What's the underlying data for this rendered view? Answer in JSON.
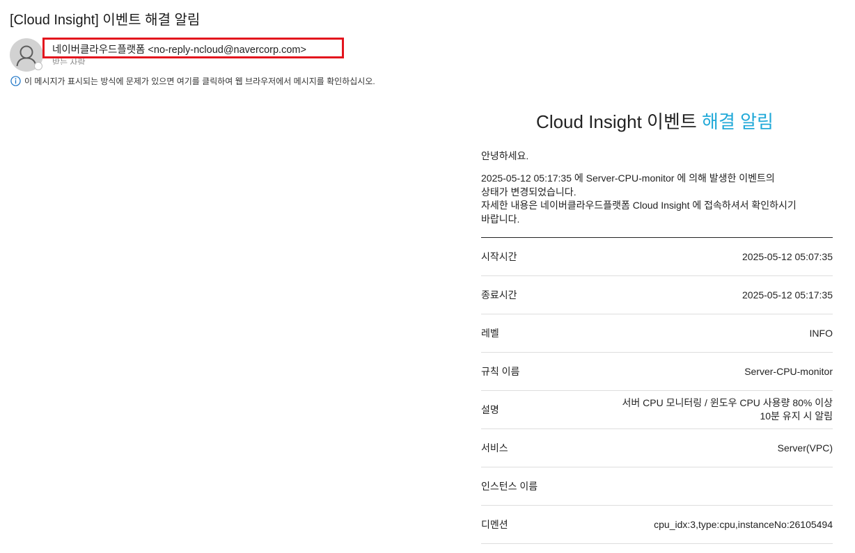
{
  "email": {
    "subject": "[Cloud Insight] 이벤트 해결 알림",
    "sender": "네이버클라우드플랫폼 <no-reply-ncloud@navercorp.com>",
    "recipient": "받는 사람",
    "info_notice": "이 메시지가 표시되는 방식에 문제가 있으면 여기를 클릭하여 웹 브라우저에서 메시지를 확인하십시오."
  },
  "mail": {
    "title_main": "Cloud Insight 이벤트",
    "title_accent": "해결 알림",
    "greeting": "안녕하세요.",
    "body_line1": "2025-05-12 05:17:35 에 Server-CPU-monitor 에 의해 발생한 이벤트의",
    "body_line2": "상태가 변경되었습니다.",
    "body_line3": "자세한 내용은 네이버클라우드플랫폼 Cloud Insight 에 접속하셔서 확인하시기",
    "body_line4": "바랍니다."
  },
  "details": [
    {
      "label": "시작시간",
      "value": "2025-05-12 05:07:35"
    },
    {
      "label": "종료시간",
      "value": "2025-05-12 05:17:35"
    },
    {
      "label": "레벨",
      "value": "INFO"
    },
    {
      "label": "규칙 이름",
      "value": "Server-CPU-monitor"
    },
    {
      "label": "설명",
      "value": "서버 CPU 모니터링 / 윈도우 CPU 사용량 80% 이상",
      "value2": "10분 유지 시 알림"
    },
    {
      "label": "서비스",
      "value": "Server(VPC)"
    },
    {
      "label": "인스턴스 이름",
      "value": ""
    },
    {
      "label": "디멘션",
      "value": "cpu_idx:3,type:cpu,instanceNo:26105494"
    }
  ],
  "colors": {
    "accent": "#21a9d8",
    "highlight_border": "#e3141d",
    "info_icon": "#1a73c6"
  },
  "icons": {
    "avatar": "person-avatar-icon",
    "info": "info-circle-icon"
  }
}
